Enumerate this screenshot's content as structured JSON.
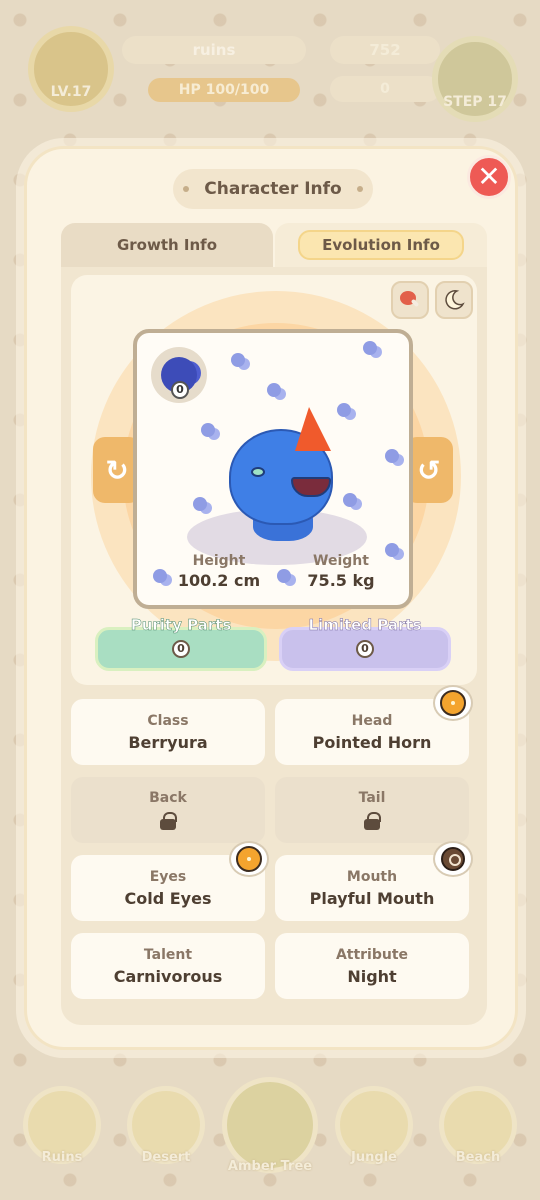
{
  "hud": {
    "level": "LV.17",
    "area": "ruins",
    "hp": "HP 100/100",
    "coins": "752",
    "food": "0",
    "step": "STEP 17"
  },
  "bottom_nav": [
    {
      "label": "Ruins"
    },
    {
      "label": "Desert"
    },
    {
      "label": "Amber Tree"
    },
    {
      "label": "Jungle"
    },
    {
      "label": "Beach"
    }
  ],
  "modal": {
    "title": "Character Info",
    "close_icon": "close-icon",
    "tabs": [
      {
        "label": "Growth Info",
        "active": false
      },
      {
        "label": "Evolution Info",
        "active": true
      }
    ],
    "buff_icons": [
      "meat-icon",
      "moon-icon"
    ],
    "seed_count": "0",
    "height_label": "Height",
    "height_value": "100.2 cm",
    "weight_label": "Weight",
    "weight_value": "75.5 kg",
    "purity_label": "Purity Parts",
    "purity_value": "0",
    "limited_label": "Limited Parts",
    "limited_value": "0",
    "attributes": [
      {
        "label": "Class",
        "value": "Berryura"
      },
      {
        "label": "Head",
        "value": "Pointed Horn",
        "badge": "orange-fruit-icon"
      },
      {
        "label": "Back",
        "locked": true
      },
      {
        "label": "Tail",
        "locked": true
      },
      {
        "label": "Eyes",
        "value": "Cold Eyes",
        "badge": "orange-fruit-icon"
      },
      {
        "label": "Mouth",
        "value": "Playful Mouth",
        "badge": "seed-icon"
      },
      {
        "label": "Talent",
        "value": "Carnivorous"
      },
      {
        "label": "Attribute",
        "value": "Night"
      }
    ]
  },
  "colors": {
    "accent_orange": "#efb86a",
    "close_red": "#ee5a55",
    "purity_green": "#a9dec2",
    "limited_purple": "#c9c1ec",
    "monster_blue": "#3f7fe6"
  }
}
